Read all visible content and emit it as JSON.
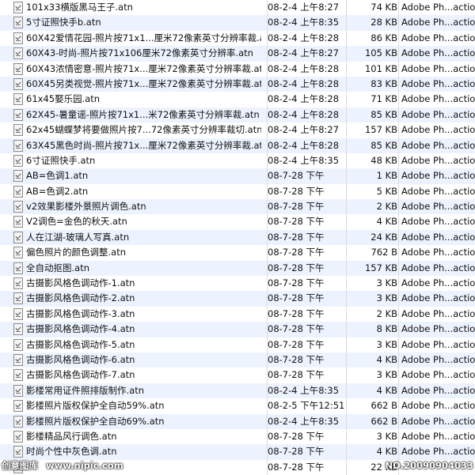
{
  "files": [
    {
      "name": "101x33横版黑马王子.atn",
      "date": "08-2-4 上午8:27",
      "size": "74 KB",
      "kind": "Adobe Ph...action"
    },
    {
      "name": "5寸证照快手b.atn",
      "date": "08-2-4 上午8:35",
      "size": "28 KB",
      "kind": "Adobe Ph...action"
    },
    {
      "name": "60X42爱情花园-照片按71x1...厘米72像素英寸分辨率裁.atn",
      "date": "08-2-4 上午8:28",
      "size": "86 KB",
      "kind": "Adobe Ph...action"
    },
    {
      "name": "60X43-时尚-照片按71x106厘米72像素英寸分辨率.atn",
      "date": "08-2-4 上午8:27",
      "size": "105 KB",
      "kind": "Adobe Ph...action"
    },
    {
      "name": "60X43浓情密意-照片按71x...厘米72像素英寸分辨率裁.atn",
      "date": "08-2-4 上午8:28",
      "size": "101 KB",
      "kind": "Adobe Ph...action"
    },
    {
      "name": "60X45另类视觉-照片按71x...厘米72像素英寸分辨率裁.atn",
      "date": "08-2-4 上午8:28",
      "size": "83 KB",
      "kind": "Adobe Ph...action"
    },
    {
      "name": "61x45娶乐园.atn",
      "date": "08-2-4 上午8:28",
      "size": "71 KB",
      "kind": "Adobe Ph...action"
    },
    {
      "name": "62X45-暑童谣-照片按71x1...米72像素英寸分辨率裁.atn",
      "date": "08-2-4 上午8:28",
      "size": "85 KB",
      "kind": "Adobe Ph...action"
    },
    {
      "name": "62x45蝴蝶梦将要做照片按7...72像素英寸分辨率裁切.atn",
      "date": "08-2-4 上午8:27",
      "size": "157 KB",
      "kind": "Adobe Ph...action"
    },
    {
      "name": "63X45黑色时尚-照片按71x...厘米72像素英寸分辨率裁.atn",
      "date": "08-2-4 上午8:28",
      "size": "85 KB",
      "kind": "Adobe Ph...action"
    },
    {
      "name": "6寸证照快手.atn",
      "date": "08-2-4 上午8:35",
      "size": "48 KB",
      "kind": "Adobe Ph...action"
    },
    {
      "name": "AB=色调1.atn",
      "date": "08-7-28 下午",
      "size": "1 KB",
      "kind": "Adobe Ph...action"
    },
    {
      "name": "AB=色调2.atn",
      "date": "08-7-28 下午",
      "size": "5 KB",
      "kind": "Adobe Ph...action"
    },
    {
      "name": "v2效果影楼外景照片调色.atn",
      "date": "08-7-28 下午",
      "size": "2 KB",
      "kind": "Adobe Ph...action"
    },
    {
      "name": "V2调色=金色的秋天.atn",
      "date": "08-7-28 下午",
      "size": "4 KB",
      "kind": "Adobe Ph...action"
    },
    {
      "name": "人在江湖-玻璃人写真.atn",
      "date": "08-7-28 下午",
      "size": "24 KB",
      "kind": "Adobe Ph...action"
    },
    {
      "name": "偏色照片的颜色调整.atn",
      "date": "08-7-28 下午",
      "size": "762 B",
      "kind": "Adobe Ph...action"
    },
    {
      "name": "全自动抠图.atn",
      "date": "08-7-28 下午",
      "size": "157 KB",
      "kind": "Adobe Ph...action"
    },
    {
      "name": "古摄影风格色调动作-1.atn",
      "date": "08-7-28 下午",
      "size": "3 KB",
      "kind": "Adobe Ph...action"
    },
    {
      "name": "古摄影风格色调动作-2.atn",
      "date": "08-7-28 下午",
      "size": "3 KB",
      "kind": "Adobe Ph...action"
    },
    {
      "name": "古摄影风格色调动作-3.atn",
      "date": "08-7-28 下午",
      "size": "2 KB",
      "kind": "Adobe Ph...action"
    },
    {
      "name": "古摄影风格色调动作-4.atn",
      "date": "08-7-28 下午",
      "size": "8 KB",
      "kind": "Adobe Ph...action"
    },
    {
      "name": "古摄影风格色调动作-5.atn",
      "date": "08-7-28 下午",
      "size": "3 KB",
      "kind": "Adobe Ph...action"
    },
    {
      "name": "古摄影风格色调动作-6.atn",
      "date": "08-7-28 下午",
      "size": "4 KB",
      "kind": "Adobe Ph...action"
    },
    {
      "name": "古摄影风格色调动作-7.atn",
      "date": "08-7-28 下午",
      "size": "3 KB",
      "kind": "Adobe Ph...action"
    },
    {
      "name": "影楼常用证件照排版制作.atn",
      "date": "08-2-4 上午8:35",
      "size": "4 KB",
      "kind": "Adobe Ph...action"
    },
    {
      "name": "影楼照片版权保护全自动59%.atn",
      "date": "08-2-5 下午12:51",
      "size": "662 B",
      "kind": "Adobe Ph...action"
    },
    {
      "name": "影楼照片版权保护全自动69%.atn",
      "date": "08-2-4 上午8:35",
      "size": "662 B",
      "kind": "Adobe Ph...action"
    },
    {
      "name": "影楼精品风行调色.atn",
      "date": "08-7-28 下午",
      "size": "3 KB",
      "kind": "Adobe Ph...action"
    },
    {
      "name": "时尚个性中灰色调.atn",
      "date": "08-7-28 下午",
      "size": "4 KB",
      "kind": "Adobe Ph...action"
    },
    {
      "name": "",
      "date": "08-7-28 下午",
      "size": "22 KB",
      "kind": ""
    }
  ],
  "watermark": {
    "left_text": "创意图库",
    "url_text": "www.nipic.com",
    "right_text": "NO.20090904033"
  }
}
